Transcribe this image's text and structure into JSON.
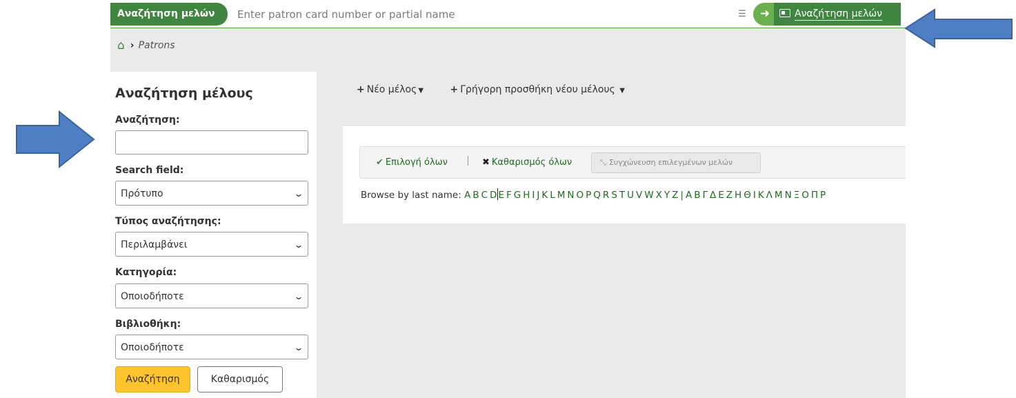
{
  "header": {
    "tab_label": "Αναζήτηση μελών",
    "search_placeholder": "Enter patron card number or partial name",
    "filter_icon": "sliders-icon",
    "go_icon": "arrow-right-icon",
    "mode_label": "Αναζήτηση μελών",
    "mode_icon": "id-card-icon"
  },
  "breadcrumb": {
    "home_icon": "home-icon",
    "current": "Patrons"
  },
  "sidebar": {
    "title": "Αναζήτηση μέλους",
    "search_label": "Αναζήτηση:",
    "search_value": "",
    "field_label": "Search field:",
    "field_value": "Πρότυπο",
    "type_label": "Τύπος αναζήτησης:",
    "type_value": "Περιλαμβάνει",
    "category_label": "Κατηγορία:",
    "category_value": "Οποιοδήποτε",
    "library_label": "Βιβλιοθήκη:",
    "library_value": "Οποιοδήποτε",
    "submit_label": "Αναζήτηση",
    "clear_label": "Καθαρισμός"
  },
  "toolbar": {
    "new_patron": "Νέο μέλος",
    "quick_add": "Γρήγορη προσθήκη νέου μέλους"
  },
  "results": {
    "select_all": "Επιλογή όλων",
    "clear_all": "Καθαρισμός όλων",
    "merge": "Συγχώνευση επιλεγμένων μελών",
    "browse_label": "Browse by last name:",
    "latin_letters": [
      "A",
      "B",
      "C",
      "D",
      "E",
      "F",
      "G",
      "H",
      "I",
      "J",
      "K",
      "L",
      "M",
      "N",
      "O",
      "P",
      "Q",
      "R",
      "S",
      "T",
      "U",
      "V",
      "W",
      "X",
      "Y",
      "Z"
    ],
    "separator": "|",
    "greek_letters": [
      "Α",
      "Β",
      "Γ",
      "Δ",
      "Ε",
      "Ζ",
      "Η",
      "Θ",
      "Ι",
      "Κ",
      "Λ",
      "Μ",
      "Ν",
      "Ξ",
      "Ο",
      "Π",
      "Ρ"
    ]
  },
  "colors": {
    "brand_green": "#408540",
    "accent_green": "#6ab04c",
    "link_green": "#1d6b1d",
    "submit_yellow": "#ffc32b",
    "arrow_blue": "#4e7fc4"
  }
}
